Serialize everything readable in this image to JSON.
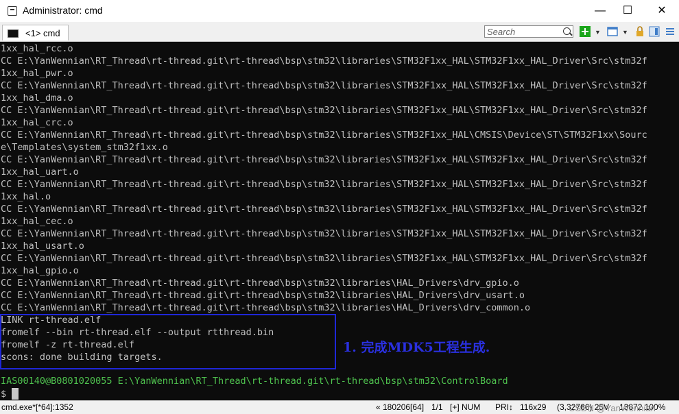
{
  "window": {
    "title": "Administrator: cmd",
    "minimize": "—",
    "maximize": "☐",
    "close": "✕"
  },
  "tab": {
    "label": "<1> cmd"
  },
  "search": {
    "placeholder": "Search"
  },
  "colors": {
    "console_bg": "#0c0c0c",
    "console_text": "#c0c0c0",
    "prompt_text": "#4fc34f",
    "highlight_box": "#1f27d8",
    "annotation": "#2a30e0"
  },
  "console": {
    "lines": [
      "1xx_hal_rcc.o",
      "CC E:\\YanWennian\\RT_Thread\\rt-thread.git\\rt-thread\\bsp\\stm32\\libraries\\STM32F1xx_HAL\\STM32F1xx_HAL_Driver\\Src\\stm32f",
      "1xx_hal_pwr.o",
      "CC E:\\YanWennian\\RT_Thread\\rt-thread.git\\rt-thread\\bsp\\stm32\\libraries\\STM32F1xx_HAL\\STM32F1xx_HAL_Driver\\Src\\stm32f",
      "1xx_hal_dma.o",
      "CC E:\\YanWennian\\RT_Thread\\rt-thread.git\\rt-thread\\bsp\\stm32\\libraries\\STM32F1xx_HAL\\STM32F1xx_HAL_Driver\\Src\\stm32f",
      "1xx_hal_crc.o",
      "CC E:\\YanWennian\\RT_Thread\\rt-thread.git\\rt-thread\\bsp\\stm32\\libraries\\STM32F1xx_HAL\\CMSIS\\Device\\ST\\STM32F1xx\\Sourc",
      "e\\Templates\\system_stm32f1xx.o",
      "CC E:\\YanWennian\\RT_Thread\\rt-thread.git\\rt-thread\\bsp\\stm32\\libraries\\STM32F1xx_HAL\\STM32F1xx_HAL_Driver\\Src\\stm32f",
      "1xx_hal_uart.o",
      "CC E:\\YanWennian\\RT_Thread\\rt-thread.git\\rt-thread\\bsp\\stm32\\libraries\\STM32F1xx_HAL\\STM32F1xx_HAL_Driver\\Src\\stm32f",
      "1xx_hal.o",
      "CC E:\\YanWennian\\RT_Thread\\rt-thread.git\\rt-thread\\bsp\\stm32\\libraries\\STM32F1xx_HAL\\STM32F1xx_HAL_Driver\\Src\\stm32f",
      "1xx_hal_cec.o",
      "CC E:\\YanWennian\\RT_Thread\\rt-thread.git\\rt-thread\\bsp\\stm32\\libraries\\STM32F1xx_HAL\\STM32F1xx_HAL_Driver\\Src\\stm32f",
      "1xx_hal_usart.o",
      "CC E:\\YanWennian\\RT_Thread\\rt-thread.git\\rt-thread\\bsp\\stm32\\libraries\\STM32F1xx_HAL\\STM32F1xx_HAL_Driver\\Src\\stm32f",
      "1xx_hal_gpio.o",
      "CC E:\\YanWennian\\RT_Thread\\rt-thread.git\\rt-thread\\bsp\\stm32\\libraries\\HAL_Drivers\\drv_gpio.o",
      "CC E:\\YanWennian\\RT_Thread\\rt-thread.git\\rt-thread\\bsp\\stm32\\libraries\\HAL_Drivers\\drv_usart.o",
      "CC E:\\YanWennian\\RT_Thread\\rt-thread.git\\rt-thread\\bsp\\stm32\\libraries\\HAL_Drivers\\drv_common.o",
      "LINK rt-thread.elf",
      "fromelf --bin rt-thread.elf --output rtthread.bin",
      "fromelf -z rt-thread.elf",
      "scons: done building targets."
    ],
    "prompt_line": "IAS00140@B0801020055 E:\\YanWennian\\RT_Thread\\rt-thread.git\\rt-thread\\bsp\\stm32\\ControlBoard",
    "input_prompt": "$"
  },
  "annotation": {
    "text": "1. 完成MDK5工程生成."
  },
  "status": {
    "process": "cmd.exe*[*64]:1352",
    "pos": "« 180206[64]",
    "page": "1/1",
    "ins": "[+] NUM",
    "pri": "PRI↕",
    "size": "116x29",
    "coord": "(3,32766) 25V",
    "extra": "13872 100%"
  },
  "watermark": "CSDN @YanWennian"
}
